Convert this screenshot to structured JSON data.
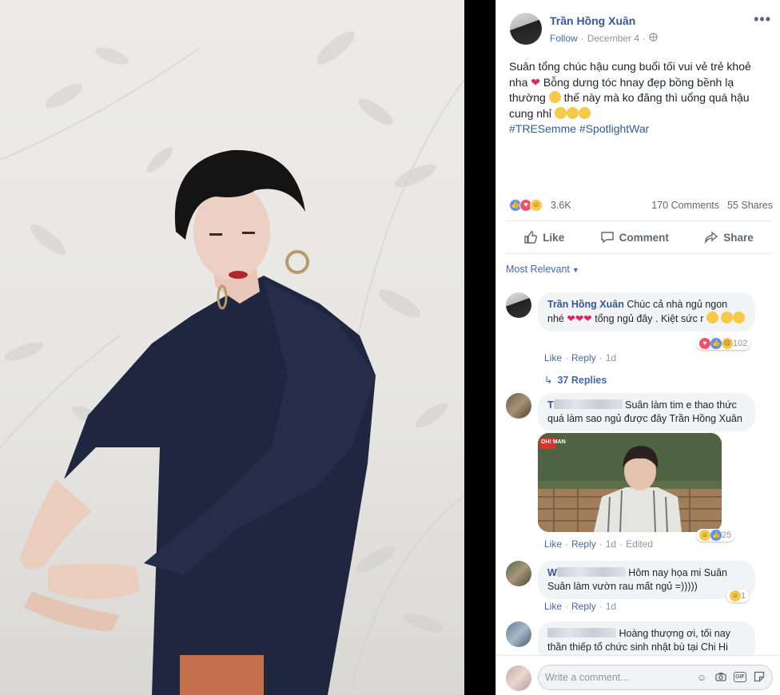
{
  "post": {
    "author": "Trần Hồng Xuân",
    "follow_label": "Follow",
    "date": "December 4",
    "dot": "·",
    "privacy_icon": "globe-icon",
    "more_label": "•••",
    "text_lines": [
      "Suân tổng chúc hậu cung buổi tối vui vẻ trẻ khoẻ",
      "nha",
      "Bỗng dưng tóc hnay đẹp bồng bềnh lạ",
      "thường",
      "thế này mà ko đăng thì uổng quá hậu",
      "cung nhỉ"
    ],
    "hashtags": "#TRESemme #SpotlightWar",
    "reaction_count": "3.6K",
    "comments_count": "170 Comments",
    "shares_count": "55 Shares"
  },
  "actions": {
    "like": "Like",
    "comment": "Comment",
    "share": "Share"
  },
  "sort_label": "Most Relevant",
  "comments": [
    {
      "author": "Trần Hồng Xuân",
      "text_a": "Chúc cả nhà ngủ ngon",
      "text_b": "nhé",
      "text_c": "tổng ngủ đây . Kiệt sức r",
      "reaction_count": "102",
      "like": "Like",
      "reply": "Reply",
      "time": "1d",
      "replies": "37 Replies"
    },
    {
      "author": "T",
      "text_a": "Suân làm tim e thao thức",
      "text_b": "quá làm sao ngủ được đây Trần Hồng Xuân",
      "gif_badge": "OH! MAN",
      "reaction_count": "25",
      "like": "Like",
      "reply": "Reply",
      "time": "1d",
      "edited": "Edited"
    },
    {
      "author": "W",
      "text_a": "Hôm nay họa mi Suân",
      "text_b": "Suân làm vườn rau mất ngủ =)))))",
      "reaction_count": "1",
      "like": "Like",
      "reply": "Reply",
      "time": "1d"
    },
    {
      "text_a": "Hoàng thượng ơi, tối nay",
      "text_b": "thần thiếp tổ chức sinh nhật bù tại Chi Hi"
    }
  ],
  "composer": {
    "placeholder": "Write a comment...",
    "icons": [
      "emoji-icon",
      "camera-icon",
      "gif-icon",
      "sticker-icon"
    ]
  },
  "colors": {
    "link": "#365899",
    "accent": "#4267b2",
    "meta": "#90949c"
  }
}
